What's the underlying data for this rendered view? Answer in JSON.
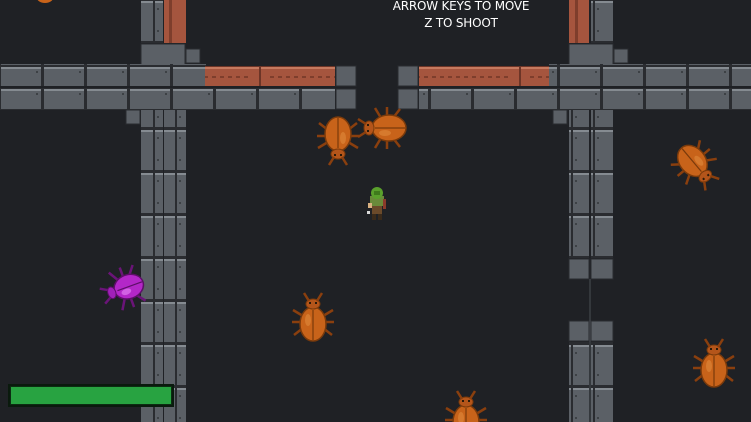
{
  "instructions": {
    "line1": "ARROW KEYS TO MOVE",
    "line2": "Z TO SHOOT"
  },
  "player": {
    "health_fraction": 1.0
  },
  "colors": {
    "background": "#1f2125",
    "stone": "#5b6066",
    "stone_highlight": "#8a9096",
    "brick": "#a5553e",
    "beetle_orange": "#c8631a",
    "beetle_magenta": "#b327c8",
    "health_fill": "#28a341"
  },
  "enemies": {
    "orange_beetle_count": 7,
    "magenta_beetle_count": 1
  }
}
